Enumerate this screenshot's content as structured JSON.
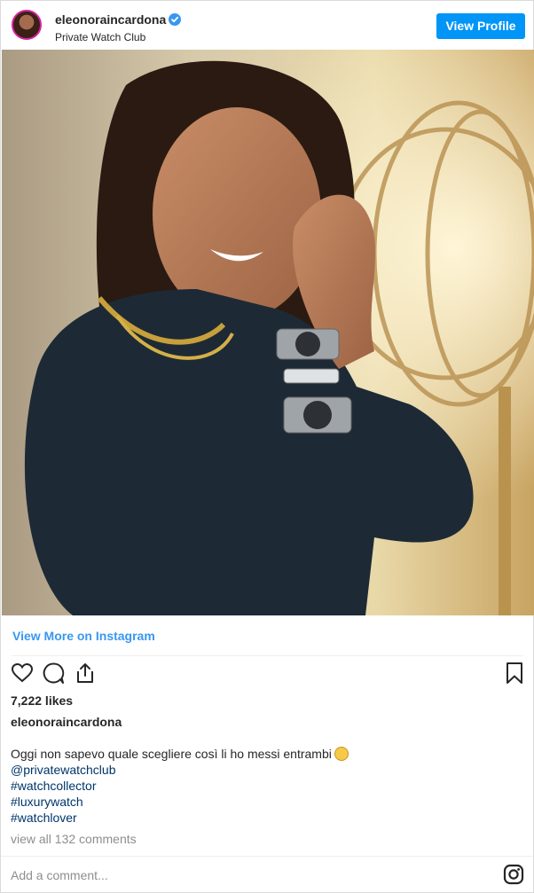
{
  "header": {
    "username": "eleonoraincardona",
    "location": "Private Watch Club",
    "view_profile_label": "View Profile",
    "verified": true
  },
  "post": {
    "view_more_label": "View More on Instagram",
    "likes": "7,222 likes",
    "owner": "eleonoraincardona",
    "caption_text": "Oggi non sapevo quale scegliere così li ho messi entrambi",
    "mentions": [
      "@privatewatchclub"
    ],
    "hashtags": [
      "#watchcollector",
      "#luxurywatch",
      "#watchlover"
    ],
    "view_comments_label": "view all 132 comments",
    "add_comment_placeholder": "Add a comment..."
  },
  "icons": {
    "like": "heart-icon",
    "comment": "comment-icon",
    "share": "share-icon",
    "save": "bookmark-icon",
    "instagram": "instagram-logo-icon"
  },
  "colors": {
    "accent": "#0095f6",
    "link": "#3897f0",
    "tag": "#003569",
    "muted": "#8e8e8e"
  }
}
